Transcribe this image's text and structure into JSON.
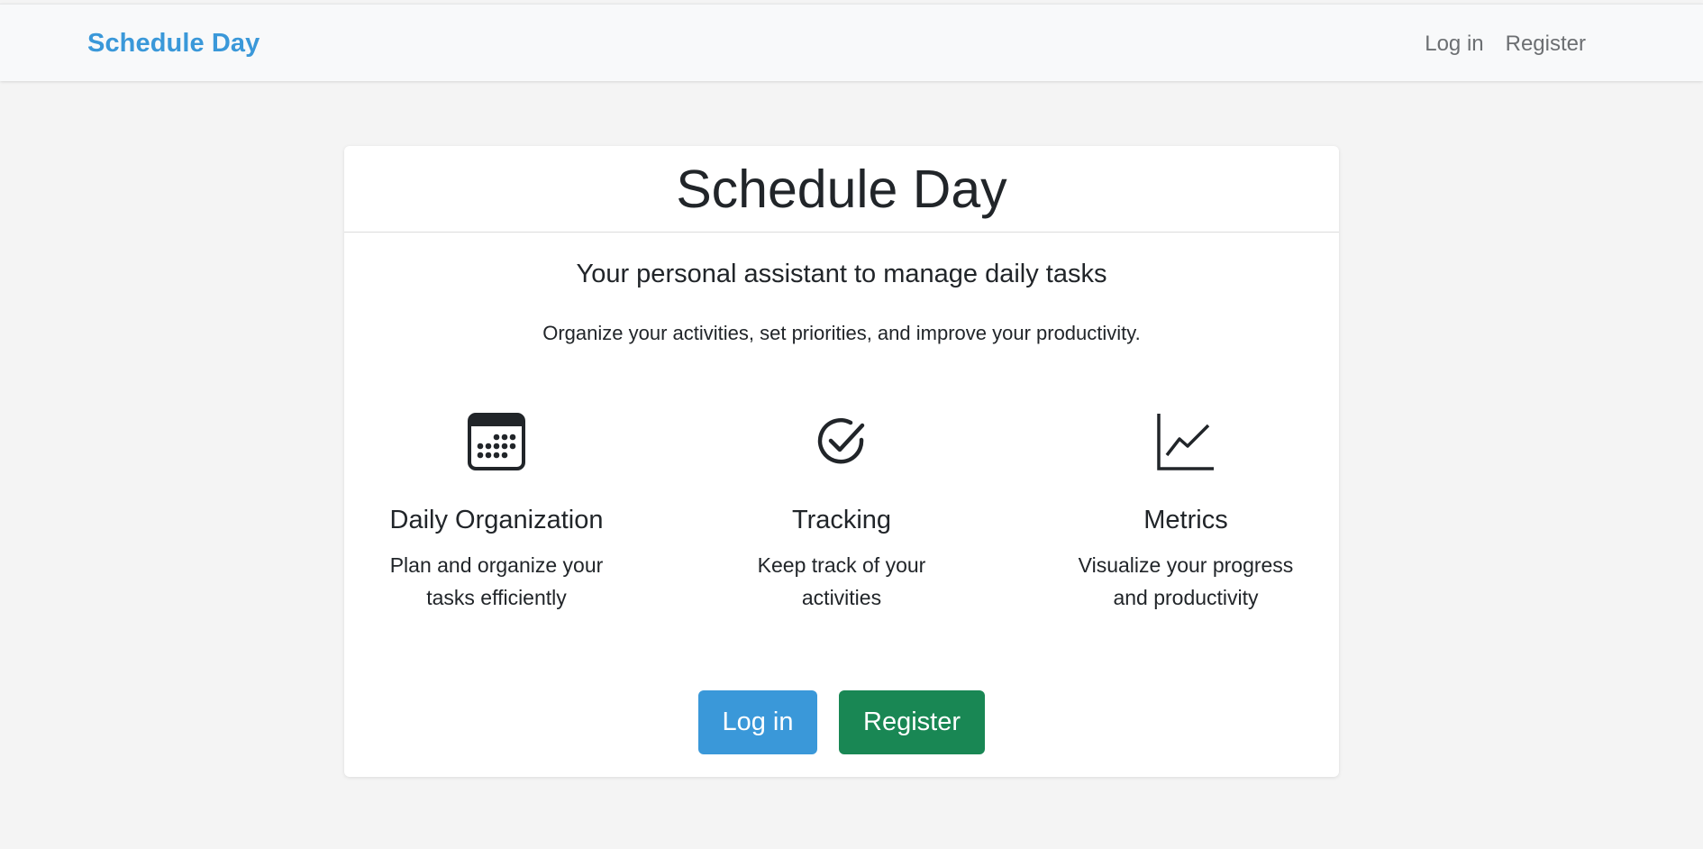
{
  "navbar": {
    "brand": "Schedule Day",
    "links": [
      "Log in",
      "Register"
    ]
  },
  "card": {
    "title": "Schedule Day",
    "lead": "Your personal assistant to manage daily tasks",
    "description": "Organize your activities, set priorities, and improve your productivity.",
    "features": [
      {
        "icon": "calendar-icon",
        "title": "Daily Organization",
        "line1": "Plan and organize your",
        "line2": "tasks efficiently"
      },
      {
        "icon": "check-circle-icon",
        "title": "Tracking",
        "line1": "Keep track of your",
        "line2": "activities"
      },
      {
        "icon": "graph-up-icon",
        "title": "Metrics",
        "line1": "Visualize your progress",
        "line2": "and productivity"
      }
    ],
    "buttons": {
      "login": "Log in",
      "register": "Register"
    }
  },
  "colors": {
    "brand": "#3a98d9",
    "primary": "#3a98d9",
    "success": "#198754",
    "background": "#f4f4f4"
  }
}
